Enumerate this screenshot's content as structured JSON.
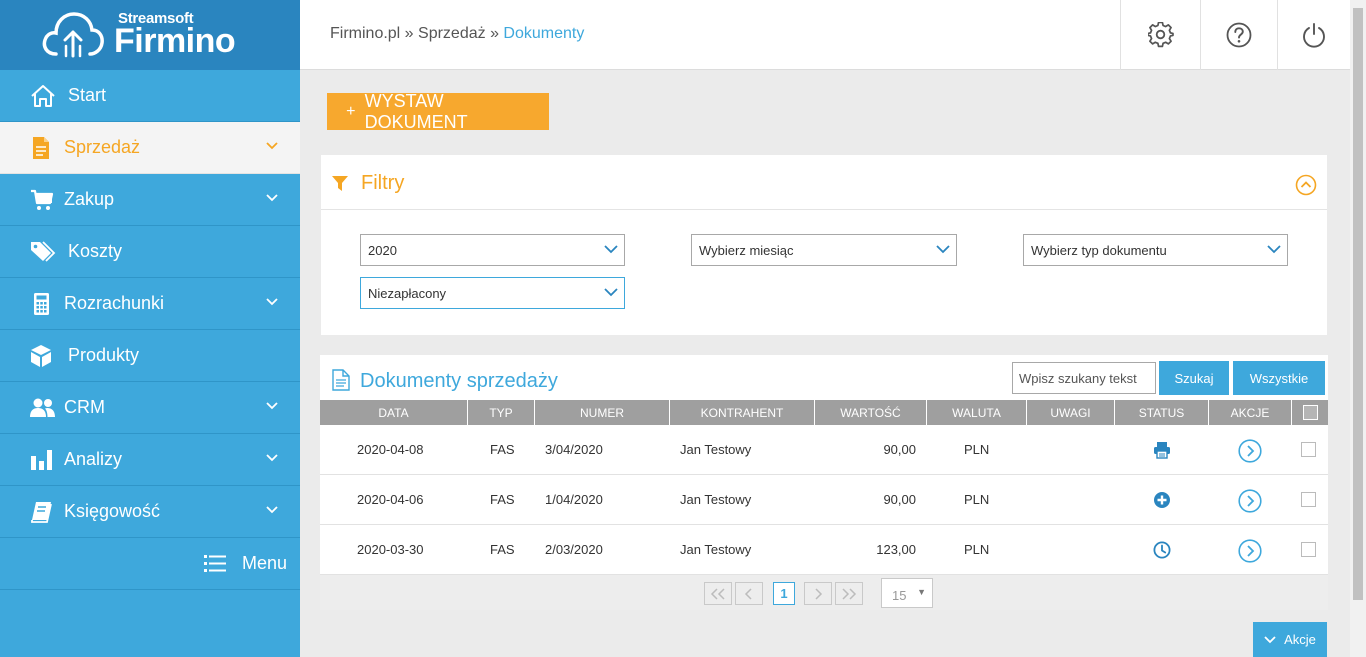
{
  "brand": {
    "small": "Streamsoft",
    "big": "Firmino"
  },
  "sidebar": {
    "items": [
      {
        "label": "Start",
        "icon": "home-icon",
        "chevron": false,
        "active": false
      },
      {
        "label": "Sprzedaż",
        "icon": "document-icon",
        "chevron": true,
        "active": true
      },
      {
        "label": "Zakup",
        "icon": "cart-icon",
        "chevron": true,
        "active": false
      },
      {
        "label": "Koszty",
        "icon": "tags-icon",
        "chevron": false,
        "active": false
      },
      {
        "label": "Rozrachunki",
        "icon": "calculator-icon",
        "chevron": true,
        "active": false
      },
      {
        "label": "Produkty",
        "icon": "box-icon",
        "chevron": false,
        "active": false
      },
      {
        "label": "CRM",
        "icon": "users-icon",
        "chevron": true,
        "active": false
      },
      {
        "label": "Analizy",
        "icon": "bar-chart-icon",
        "chevron": true,
        "active": false
      },
      {
        "label": "Księgowość",
        "icon": "book-icon",
        "chevron": true,
        "active": false
      }
    ],
    "menu_label": "Menu"
  },
  "breadcrumb": {
    "root": "Firmino.pl",
    "section": "Sprzedaż",
    "current": "Dokumenty",
    "sep": " » "
  },
  "issue_button": {
    "plus": "+",
    "label": "WYSTAW DOKUMENT"
  },
  "filters": {
    "title": "Filtry",
    "year": "2020",
    "month": "Wybierz miesiąc",
    "doc_type": "Wybierz typ dokumentu",
    "payment": "Niezapłacony"
  },
  "documents": {
    "title": "Dokumenty sprzedaży",
    "search_placeholder": "Wpisz szukany tekst",
    "search_button": "Szukaj",
    "all_button": "Wszystkie",
    "columns": {
      "date": "DATA",
      "type": "TYP",
      "number": "NUMER",
      "contractor": "KONTRAHENT",
      "value": "WARTOŚĆ",
      "currency": "WALUTA",
      "notes": "UWAGI",
      "status": "STATUS",
      "actions": "AKCJE"
    },
    "rows": [
      {
        "date": "2020-04-08",
        "type": "FAS",
        "number": "3/04/2020",
        "contractor": "Jan Testowy",
        "value": "90,00",
        "currency": "PLN",
        "status_icon": "printer-icon"
      },
      {
        "date": "2020-04-06",
        "type": "FAS",
        "number": "1/04/2020",
        "contractor": "Jan Testowy",
        "value": "90,00",
        "currency": "PLN",
        "status_icon": "plus-circle-icon"
      },
      {
        "date": "2020-03-30",
        "type": "FAS",
        "number": "2/03/2020",
        "contractor": "Jan Testowy",
        "value": "123,00",
        "currency": "PLN",
        "status_icon": "clock-icon"
      }
    ]
  },
  "pager": {
    "current_page": "1",
    "page_size": "15"
  },
  "actions_button": "Akcje",
  "colors": {
    "sidebar": "#3ea8dc",
    "logo_bg": "#2a85bf",
    "accent_orange": "#f7a82e",
    "accent_blue": "#3ea8dc"
  }
}
